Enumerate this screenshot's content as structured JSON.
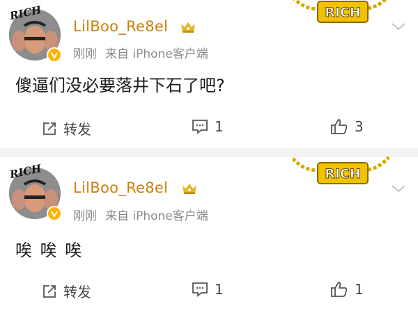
{
  "posts": [
    {
      "username": "LilBoo_Re8el",
      "time": "刚刚",
      "source": "来自 iPhone客户端",
      "content": "傻逼们没必要落井下石了吧?",
      "repost_label": "转发",
      "comment_count": "1",
      "like_count": "3",
      "avatar_label": "RICH",
      "pendant_label": "RICH"
    },
    {
      "username": "LilBoo_Re8el",
      "time": "刚刚",
      "source": "来自 iPhone客户端",
      "content": "唉 唉 唉",
      "repost_label": "转发",
      "comment_count": "1",
      "like_count": "1",
      "avatar_label": "RICH",
      "pendant_label": "RICH"
    }
  ],
  "colors": {
    "username": "#c9810b",
    "meta": "#8a8a8a",
    "badge": "#ffb400",
    "separator": "#f2f2f2",
    "gold": "#e8b800"
  }
}
